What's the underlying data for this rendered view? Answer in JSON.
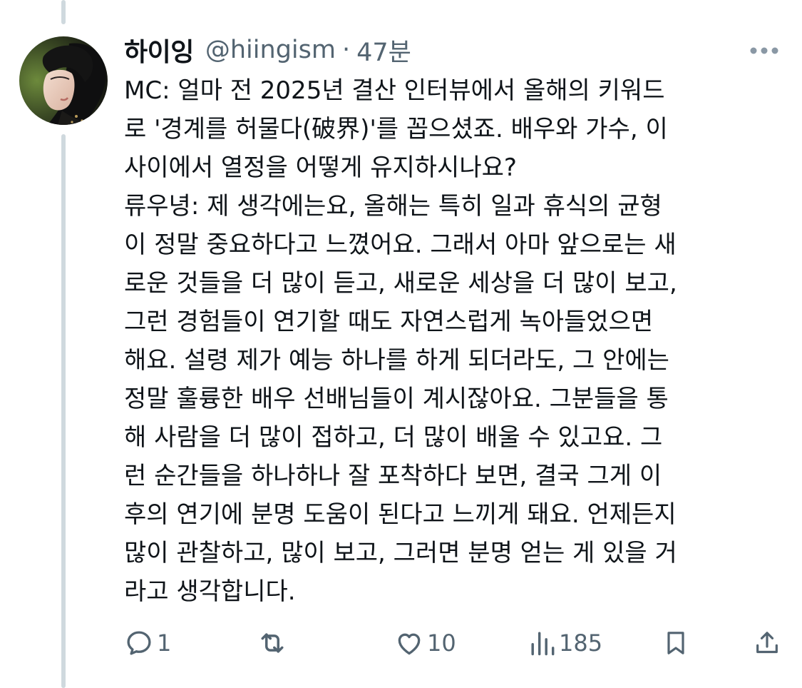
{
  "author": {
    "display_name": "하이잉",
    "handle": "@hiingism",
    "separator": "·",
    "time": "47분"
  },
  "tweet": {
    "lines": [
      "MC: 얼마 전 2025년 결산 인터뷰에서 올해의 키워드",
      "로 '경계를 허물다(破界)'를 꼽으셨죠. 배우와 가수, 이",
      "사이에서 열정을 어떻게 유지하시나요?",
      "류우녕: 제 생각에는요, 올해는 특히 일과 휴식의 균형",
      "이 정말 중요하다고 느꼈어요. 그래서 아마 앞으로는 새",
      "로운 것들을 더 많이 듣고, 새로운 세상을 더 많이 보고,",
      "그런 경험들이 연기할 때도 자연스럽게 녹아들었으면",
      "해요. 설령 제가 예능 하나를 하게 되더라도, 그 안에는",
      "정말 훌륭한 배우 선배님들이 계시잖아요. 그분들을 통",
      "해 사람을 더 많이 접하고, 더 많이 배울 수 있고요. 그",
      "런 순간들을 하나하나 잘 포착하다 보면, 결국 그게 이",
      "후의 연기에 분명 도움이 된다고 느끼게 돼요. 언제든지",
      "많이 관찰하고, 많이 보고, 그러면 분명 얻는 게 있을 거",
      "라고 생각합니다."
    ]
  },
  "actions": {
    "reply": {
      "icon": "reply-icon",
      "count": "1"
    },
    "retweet": {
      "icon": "retweet-icon",
      "count": ""
    },
    "like": {
      "icon": "heart-icon",
      "count": "10"
    },
    "views": {
      "icon": "views-icon",
      "count": "185"
    },
    "bookmark": {
      "icon": "bookmark-icon"
    },
    "share": {
      "icon": "share-icon"
    }
  },
  "colors": {
    "text": "#0f1419",
    "secondary": "#536471",
    "thread_line": "#cfd9de"
  }
}
